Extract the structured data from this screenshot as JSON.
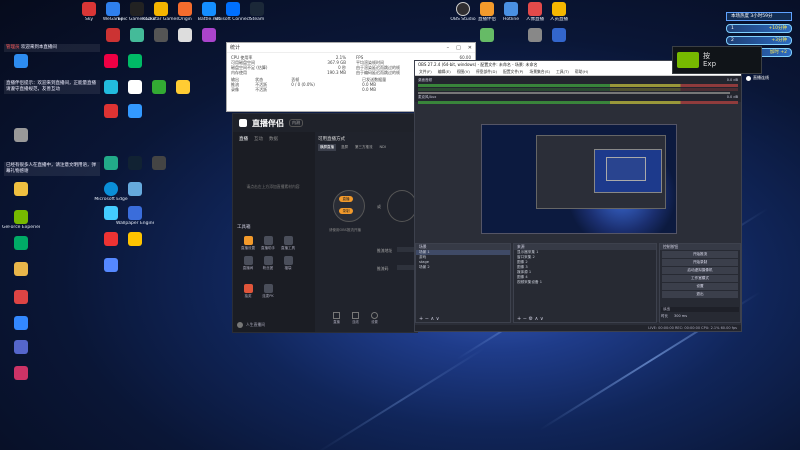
{
  "desktop": {
    "row1": [
      "Sky",
      "WeGame",
      "Epic Games Launcher",
      "Rockstar Games Launcher",
      "Origin",
      "Battle.net",
      "Ubisoft Connect",
      "Steam"
    ],
    "col_icons": [
      "Microsoft Edge",
      "GeForce Experience",
      "Microsoft Teams",
      "Wallpaper Engine",
      "Sony Vegas",
      "Premiere",
      "NVIDIA Broadcast",
      "Xbox"
    ],
    "top_right": [
      "OBS Studio",
      "直播伴侣",
      "Hotline",
      "人像直播",
      "人员直播"
    ],
    "notice": {
      "highlight": "管理员",
      "text": "欢迎来到本直播间"
    },
    "notice2": "直播伴侣提示：欢迎来到直播间，正能量直播请遵守直播规范，友善互动",
    "notice3": "已经有很多人在直播中，请注意文明用语，弹幕礼物感谢"
  },
  "stats_window": {
    "title": "统计",
    "left_rows": [
      {
        "k": "CPU 使用率",
        "v": "2.1%"
      },
      {
        "k": "可用磁盘空间",
        "v": "367.9 GB"
      },
      {
        "k": "磁盘空间不足 (估算)",
        "v": "0 秒"
      },
      {
        "k": "内存使用",
        "v": "190.3 MB"
      }
    ],
    "right_rows": [
      {
        "k": "FPS",
        "v": "60.00"
      },
      {
        "k": "平均渲染帧时间",
        "v": "0.5 ms"
      },
      {
        "k": "由于渲染延迟而跳过的帧",
        "v": "0 / 0"
      },
      {
        "k": "由于编码延迟而跳过的帧",
        "v": "0 / 0"
      }
    ],
    "table_headers": [
      "输出",
      "状态",
      "丢帧",
      "已发送数据量",
      "比特率"
    ],
    "table_rows": [
      [
        "推流",
        "不活跃",
        "0 / 0 (0.0%)",
        "0.0 MB",
        "0 kb/s"
      ],
      [
        "录像",
        "不活跃",
        "",
        "0.0 MB",
        "0 kb/s"
      ]
    ]
  },
  "live_companion": {
    "logo": "直播伴侣",
    "version": "内测",
    "tabs": [
      "直播",
      "互动",
      "数据"
    ],
    "left_hint": "请点击左上方添加直播素材内容",
    "section": "工具箱",
    "tools": [
      "直播设置",
      "直播助手",
      "直播工具",
      "直播间",
      "粉丝团",
      "福袋",
      "抽奖",
      "连麦PK"
    ],
    "footer": "人生直播间",
    "right_title": "可用直播方式",
    "right_tabs": [
      "横屏直播",
      "竖屏",
      "第三方推流",
      "NDI",
      "其他"
    ],
    "right_label1": "推流地址",
    "right_label2": "推流码",
    "pill1": "直播",
    "pill2": "录制",
    "or": "或",
    "right_hint": "请使用OBS推流开播",
    "bottom_btns": [
      "直播",
      "连线",
      "设置"
    ]
  },
  "obs": {
    "title": "OBS 27.2.4 (64-bit, windows) - 配置文件: 未命名 - 场景: 未命名",
    "menu": [
      "文件(F)",
      "编辑(E)",
      "视图(V)",
      "停靠部件(D)",
      "配置文件(P)",
      "场景集合(S)",
      "工具(T)",
      "帮助(H)"
    ],
    "mixer_title": "音频混音器",
    "tracks": [
      {
        "name": "桌面音频",
        "db": "0.0 dB"
      },
      {
        "name": "麦克风/Aux",
        "db": "0.0 dB"
      }
    ],
    "scenes_header": "场景",
    "scenes": [
      "场景 1",
      "游戏",
      "stage",
      "场景 2"
    ],
    "sources_header": "来源",
    "sources": [
      "显示器采集 1",
      "窗口采集 2",
      "图像 2",
      "图像 3",
      "媒体源 1",
      "图像 4",
      "视频采集设备 1"
    ],
    "controls_header": "控制按钮",
    "controls": [
      "开始推流",
      "开始录制",
      "启动虚拟摄像机",
      "工作室模式",
      "设置",
      "退出"
    ],
    "transition_label": "淡出",
    "duration_label": "时长",
    "duration": "300 ms",
    "status": "LIVE: 00:00:00  REC: 00:00:00  CPU: 2.1%  60.00 fps"
  },
  "overlay": {
    "header": "本场热度 3小时59分",
    "bars": [
      {
        "rank": "1",
        "value": "+10分钟"
      },
      {
        "rank": "2",
        "value": "+3分钟"
      },
      {
        "rank": "3",
        "value": "加时 +2"
      }
    ],
    "nvidia_line1": "按",
    "nvidia_line2": "Exp",
    "badge": "直播连线"
  },
  "colors": {
    "accent": "#f39a2b",
    "obs_bg": "#2b2e38",
    "nvidia": "#76b900"
  }
}
